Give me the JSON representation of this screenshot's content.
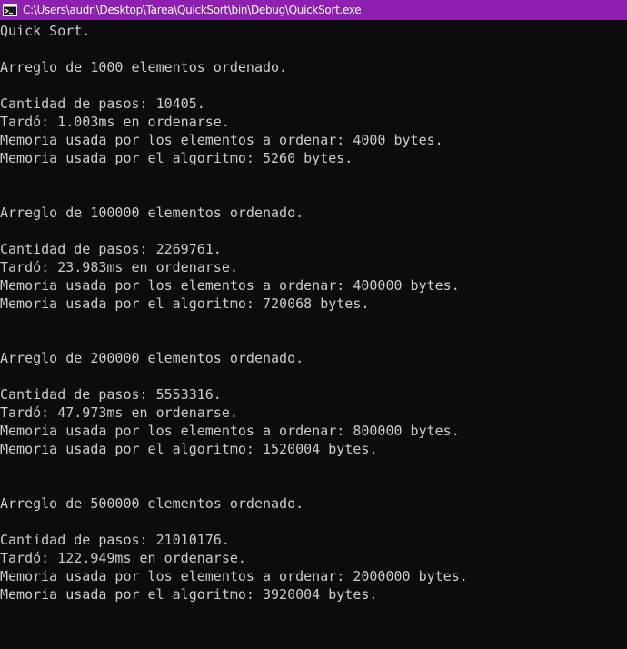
{
  "window": {
    "title": "C:\\Users\\audri\\Desktop\\Tarea\\QuickSort\\bin\\Debug\\QuickSort.exe",
    "titlebar_color": "#8e1fb0",
    "icon": "console-app-icon"
  },
  "console": {
    "background": "#0c0c0c",
    "foreground": "#cccccc",
    "lines": [
      "Quick Sort.",
      "",
      "Arreglo de 1000 elementos ordenado.",
      "",
      "Cantidad de pasos: 10405.",
      "Tardó: 1.003ms en ordenarse.",
      "Memoria usada por los elementos a ordenar: 4000 bytes.",
      "Memoria usada por el algoritmo: 5260 bytes.",
      "",
      "",
      "Arreglo de 100000 elementos ordenado.",
      "",
      "Cantidad de pasos: 2269761.",
      "Tardó: 23.983ms en ordenarse.",
      "Memoria usada por los elementos a ordenar: 400000 bytes.",
      "Memoria usada por el algoritmo: 720068 bytes.",
      "",
      "",
      "Arreglo de 200000 elementos ordenado.",
      "",
      "Cantidad de pasos: 5553316.",
      "Tardó: 47.973ms en ordenarse.",
      "Memoria usada por los elementos a ordenar: 800000 bytes.",
      "Memoria usada por el algoritmo: 1520004 bytes.",
      "",
      "",
      "Arreglo de 500000 elementos ordenado.",
      "",
      "Cantidad de pasos: 21010176.",
      "Tardó: 122.949ms en ordenarse.",
      "Memoria usada por los elementos a ordenar: 2000000 bytes.",
      "Memoria usada por el algoritmo: 3920004 bytes."
    ]
  }
}
